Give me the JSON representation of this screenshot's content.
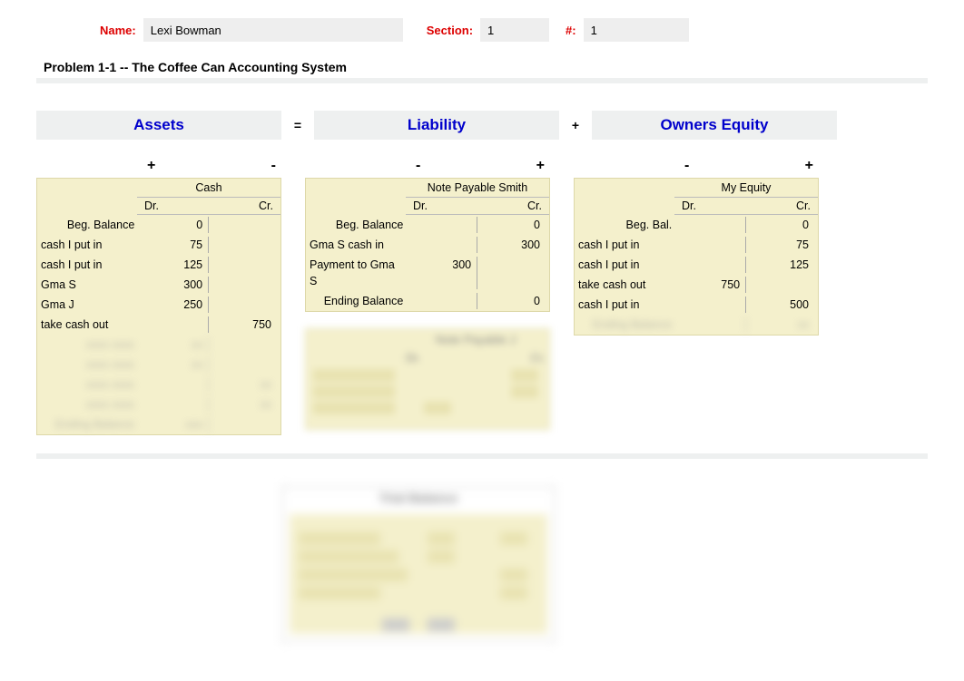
{
  "header": {
    "name_label": "Name:",
    "name_value": "Lexi Bowman",
    "section_label": "Section:",
    "section_value": "1",
    "num_label": "#:",
    "num_value": "1"
  },
  "problem_title": "Problem 1-1 -- The Coffee Can Accounting System",
  "equation": {
    "assets": "Assets",
    "eq": "=",
    "liability": "Liability",
    "plus": "+",
    "owners": "Owners Equity"
  },
  "signs": {
    "assets_left": "+",
    "assets_right": "-",
    "liab_left": "-",
    "liab_right": "+",
    "eq_left": "-",
    "eq_right": "+"
  },
  "taccounts": {
    "cash": {
      "title": "Cash",
      "dr": "Dr.",
      "cr": "Cr.",
      "rows": [
        {
          "desc": "Beg. Balance",
          "dr": "0",
          "cr": ""
        },
        {
          "desc": "cash I put in",
          "dr": "75",
          "cr": ""
        },
        {
          "desc": "cash I put in",
          "dr": "125",
          "cr": ""
        },
        {
          "desc": "Gma S",
          "dr": "300",
          "cr": ""
        },
        {
          "desc": "Gma J",
          "dr": "250",
          "cr": ""
        },
        {
          "desc": "take cash out",
          "dr": "",
          "cr": "750"
        }
      ]
    },
    "note": {
      "title": "Note Payable Smith",
      "dr": "Dr.",
      "cr": "Cr.",
      "rows": [
        {
          "desc": "Beg. Balance",
          "dr": "",
          "cr": "0"
        },
        {
          "desc": "Gma S cash in",
          "dr": "",
          "cr": "300"
        },
        {
          "desc": "Payment to Gma S",
          "dr": "300",
          "cr": ""
        },
        {
          "desc": "Ending Balance",
          "dr": "",
          "cr": "0"
        }
      ]
    },
    "equity": {
      "title": "My Equity",
      "dr": "Dr.",
      "cr": "Cr.",
      "rows": [
        {
          "desc": "Beg. Bal.",
          "dr": "",
          "cr": "0"
        },
        {
          "desc": "cash I put in",
          "dr": "",
          "cr": "75"
        },
        {
          "desc": "cash I put in",
          "dr": "",
          "cr": "125"
        },
        {
          "desc": "take cash out",
          "dr": "750",
          "cr": ""
        },
        {
          "desc": "cash I put in",
          "dr": "",
          "cr": "500"
        }
      ]
    }
  }
}
